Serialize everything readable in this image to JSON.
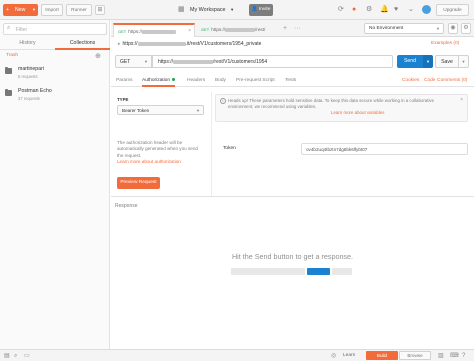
{
  "header": {
    "new_label": "New",
    "import_label": "Import",
    "runner_label": "Runner",
    "workspace_label": "My Workspace",
    "invite_label": "Invite",
    "upgrade_label": "Upgrade"
  },
  "sidebar": {
    "filter_placeholder": "Filter",
    "tabs": [
      "History",
      "Collections"
    ],
    "active_tab": "Collections",
    "trash_label": "Trash",
    "collections": [
      {
        "name": "martinepari",
        "count": "6 requests"
      },
      {
        "name": "Postman Echo",
        "count": "37 requests"
      }
    ]
  },
  "tabs": {
    "request_tabs": [
      {
        "method": "GET",
        "title_prefix": "https://"
      },
      {
        "method": "GET",
        "title_prefix": "https://",
        "title_suffix": "/rest/"
      }
    ],
    "environment": "No Environment"
  },
  "request": {
    "name_prefix": "https://",
    "name_suffix": ".it/rest/V1/customers/1954_private",
    "examples_label": "Examples (0)",
    "method": "GET",
    "url_prefix": "https://",
    "url_suffix": "/rest/V1/customers/1954",
    "send_label": "Send",
    "save_label": "Save"
  },
  "request_tabs": {
    "items": [
      "Params",
      "Authorization",
      "Headers",
      "Body",
      "Pre-request Script",
      "Tests"
    ],
    "active": "Authorization",
    "cookies_label": "Cookies",
    "code_label": "Code",
    "comments_label": "Comments (0)"
  },
  "auth": {
    "type_label": "TYPE",
    "type_value": "Bearer Token",
    "description": "The authorization header will be automatically generated when you send the request.",
    "learn_more": "Learn more about authorization",
    "preview_label": "Preview Request",
    "warning_text": "Heads up! These parameters hold sensitive data. To keep this data secure while working in a collaborative environment, we recommend using variables.",
    "warning_link": "Learn more about variables",
    "token_label": "Token",
    "token_value": "ov4b2uq4tbztn7dg6bk6lfybt07"
  },
  "response": {
    "label": "Response",
    "empty_message": "Hit the Send button to get a response."
  },
  "statusbar": {
    "learn_label": "Learn",
    "build_label": "Build",
    "browse_label": "Browse"
  },
  "colors": {
    "accent": "#f26b3a",
    "send_blue": "#1b82d1",
    "get_green": "#1ca34b"
  }
}
